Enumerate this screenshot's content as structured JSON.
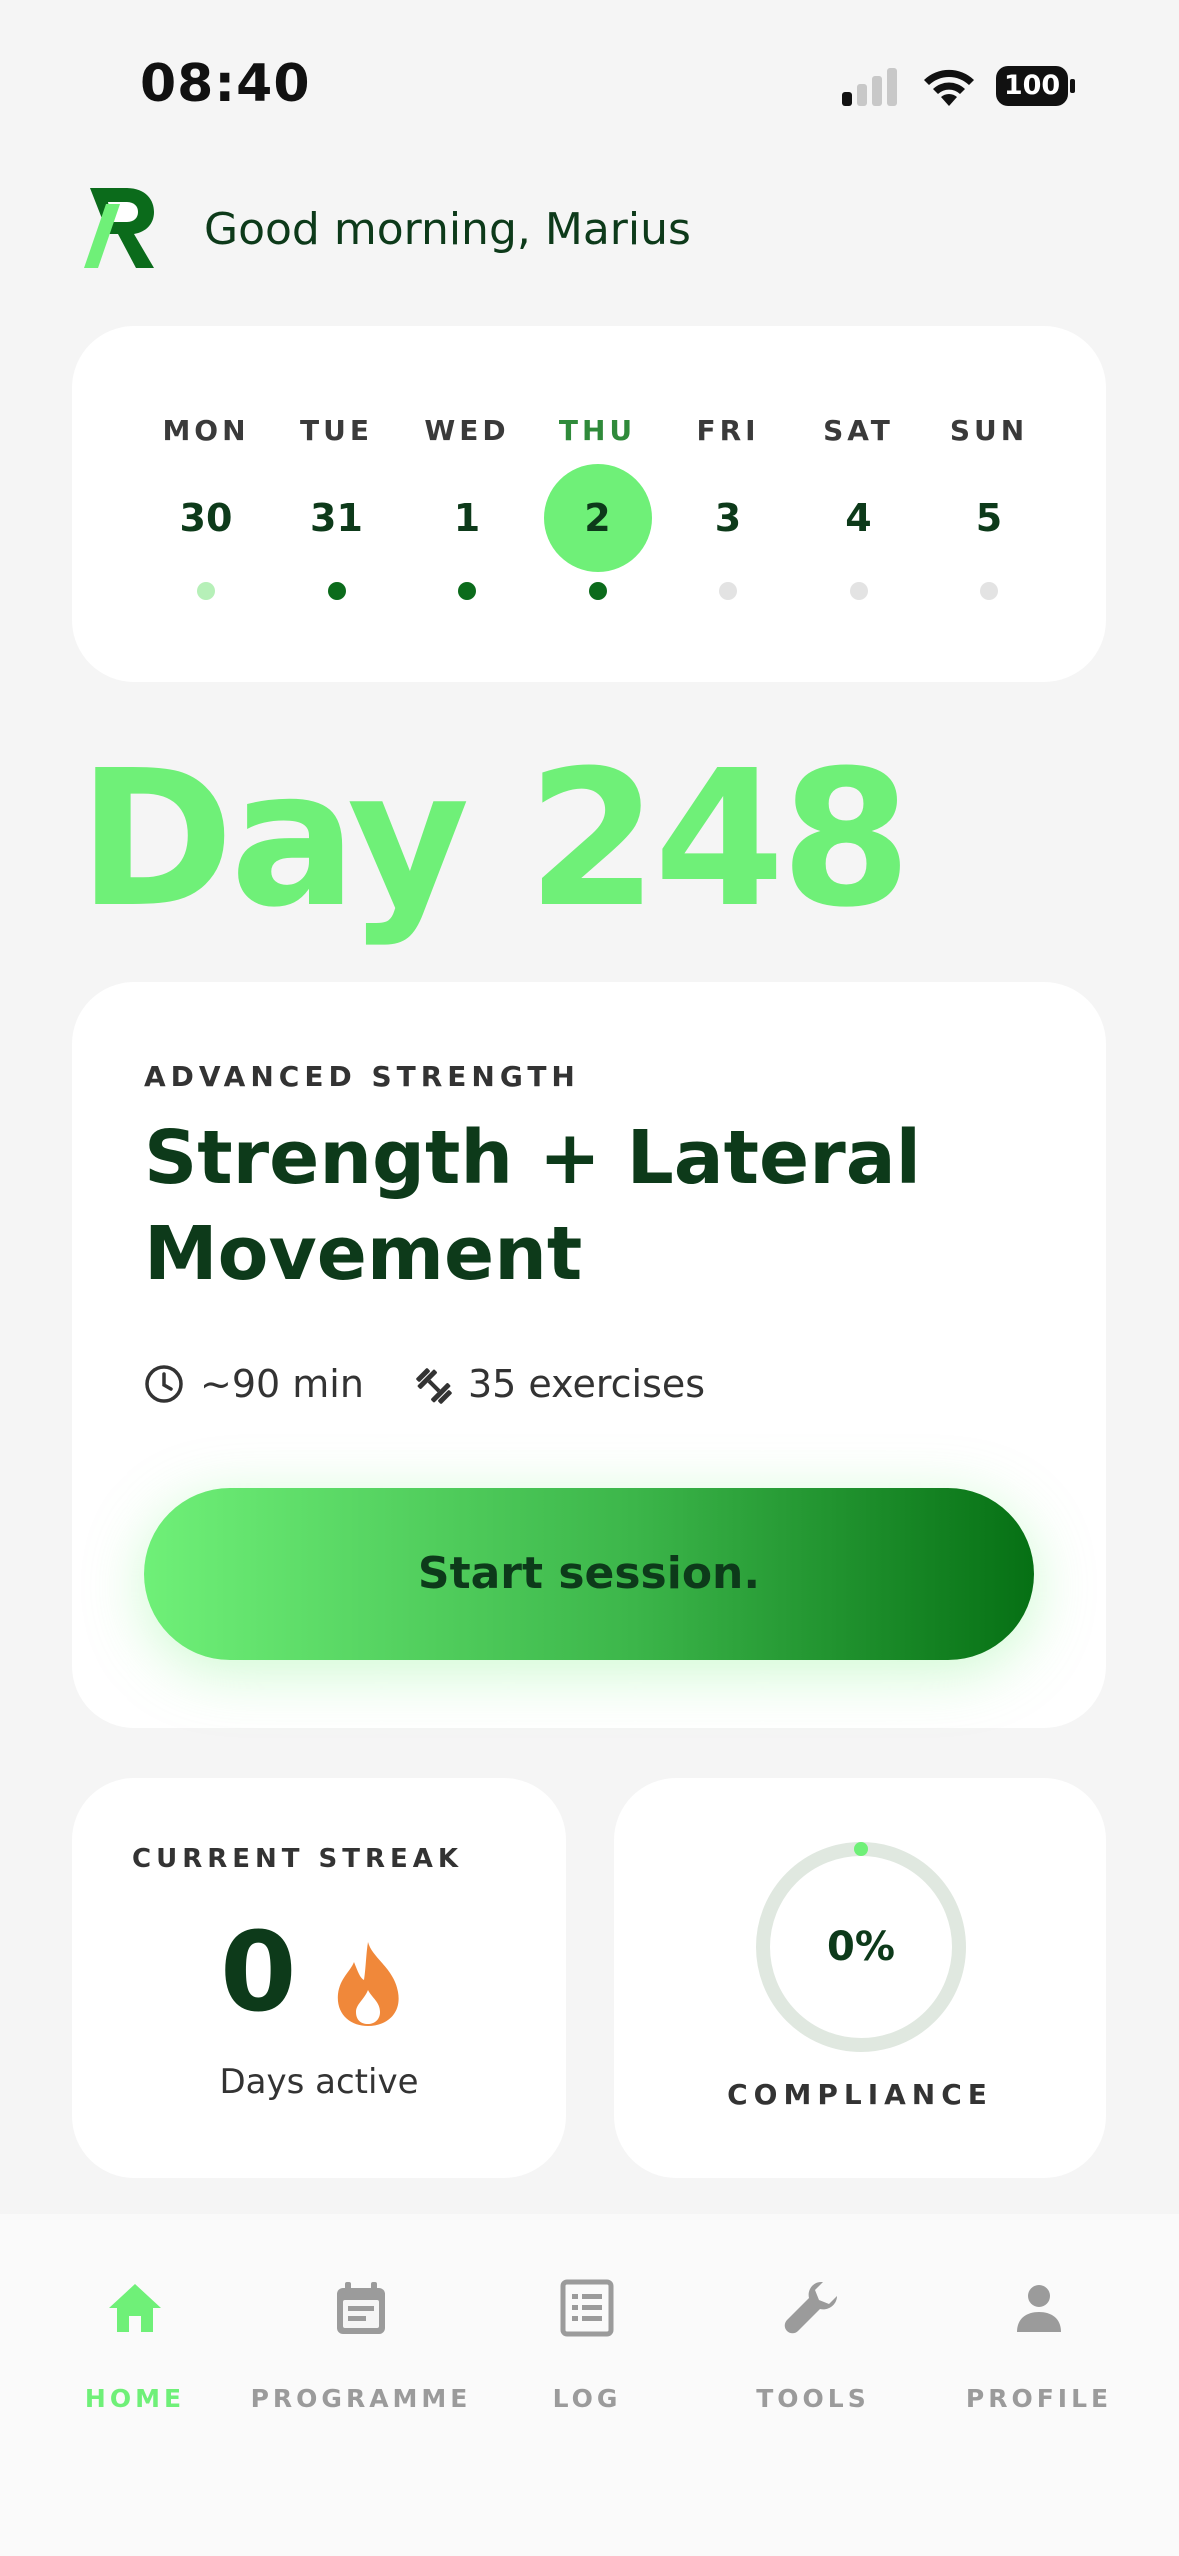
{
  "status_bar": {
    "time": "08:40",
    "battery": "100"
  },
  "header": {
    "greeting": "Good morning, Marius"
  },
  "calendar": {
    "days": [
      {
        "day": "MON",
        "date": "30",
        "dot": "#b6f0b8",
        "active": false
      },
      {
        "day": "TUE",
        "date": "31",
        "dot": "#0b6b1b",
        "active": false
      },
      {
        "day": "WED",
        "date": "1",
        "dot": "#0b6b1b",
        "active": false
      },
      {
        "day": "THU",
        "date": "2",
        "dot": "#0b6b1b",
        "active": true
      },
      {
        "day": "FRI",
        "date": "3",
        "dot": "#e3e3e3",
        "active": false
      },
      {
        "day": "SAT",
        "date": "4",
        "dot": "#e3e3e3",
        "active": false
      },
      {
        "day": "SUN",
        "date": "5",
        "dot": "#e3e3e3",
        "active": false
      }
    ]
  },
  "day_title": "Day 248",
  "session": {
    "label": "ADVANCED STRENGTH",
    "title": "Strength + Lateral Movement",
    "duration": "~90 min",
    "duration_icon": "clock-icon",
    "exercises": "35 exercises",
    "exercises_icon": "dumbbell-icon",
    "start_label": "Start session."
  },
  "streak": {
    "label": "CURRENT STREAK",
    "value": "0",
    "icon": "flame-icon",
    "sub": "Days active"
  },
  "compliance": {
    "value": "0%",
    "fraction": 0,
    "label": "COMPLIANCE"
  },
  "tabs": [
    {
      "label": "HOME",
      "icon": "home-icon",
      "active": true
    },
    {
      "label": "PROGRAMME",
      "icon": "calendar-icon",
      "active": false
    },
    {
      "label": "LOG",
      "icon": "list-icon",
      "active": false
    },
    {
      "label": "TOOLS",
      "icon": "wrench-icon",
      "active": false
    },
    {
      "label": "PROFILE",
      "icon": "person-icon",
      "active": false
    }
  ],
  "colors": {
    "accent": "#6ff078",
    "dark_green": "#0d3a1a",
    "background": "#f5f5f5",
    "flame": "#f0883a"
  }
}
